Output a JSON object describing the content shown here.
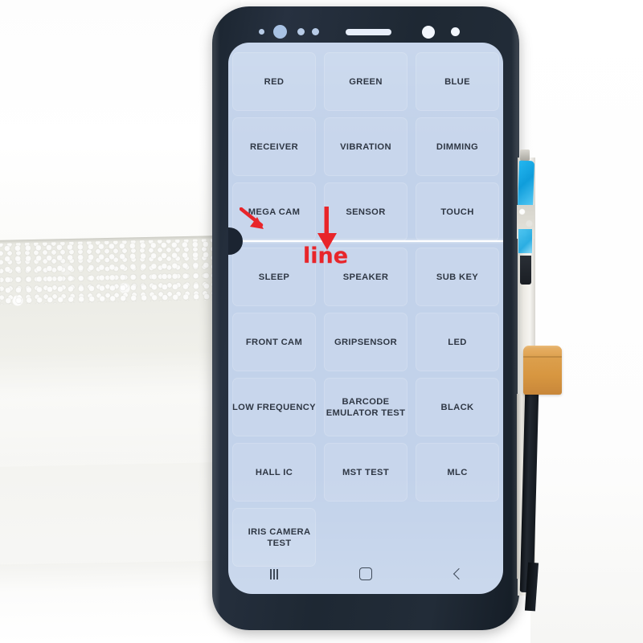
{
  "scene": {
    "subject": "Samsung Galaxy S8 display module under diagnostic test",
    "background_label": "white styrofoam foam block"
  },
  "phone": {
    "top_bezel": {
      "sensors": [
        {
          "name": "proximity-sensor-dot",
          "size": "small"
        },
        {
          "name": "iris-scanner-dot",
          "size": "large"
        },
        {
          "name": "light-sensor-dot",
          "size": "small"
        },
        {
          "name": "aux-sensor-dot",
          "size": "small"
        },
        {
          "name": "earpiece-speaker-slot",
          "size": "slot"
        },
        {
          "name": "front-camera-lens",
          "size": "camera"
        },
        {
          "name": "led-indicator",
          "size": "small-camera"
        }
      ]
    }
  },
  "screen": {
    "background_color": "#c2d2ea",
    "text_color": "#17202e",
    "grid": {
      "columns": 3,
      "rows": [
        [
          "RED",
          "GREEN",
          "BLUE"
        ],
        [
          "RECEIVER",
          "VIBRATION",
          "DIMMING"
        ],
        [
          "MEGA CAM",
          "SENSOR",
          "TOUCH"
        ],
        [
          "SLEEP",
          "SPEAKER",
          "SUB KEY"
        ],
        [
          "FRONT CAM",
          "GRIPSENSOR",
          "LED"
        ],
        [
          "LOW FREQUENCY",
          "BARCODE EMULATOR TEST",
          "BLACK"
        ],
        [
          "HALL IC",
          "MST TEST",
          "MLC"
        ],
        [
          "IRIS CAMERA TEST",
          "",
          ""
        ]
      ]
    }
  },
  "defect": {
    "type": "horizontal-white-line",
    "color": "#ffffff",
    "annotation_label": "line",
    "annotation_color": "#e8252a",
    "arrows": [
      {
        "name": "diagonal-arrow",
        "direction": "down-right"
      },
      {
        "name": "vertical-arrow",
        "direction": "down"
      }
    ]
  },
  "navbar": {
    "buttons": [
      {
        "name": "recents-button",
        "icon": "recents-icon"
      },
      {
        "name": "home-button",
        "icon": "home-icon"
      },
      {
        "name": "back-button",
        "icon": "back-icon"
      }
    ]
  },
  "hardware": {
    "flex_cable_color": "#d79640",
    "tape_color": "#1aa8e2",
    "cable_color": "#14191f",
    "parts": [
      {
        "name": "blue-adhesive-tape"
      },
      {
        "name": "orange-flex-cable"
      },
      {
        "name": "black-ribbon-cable"
      },
      {
        "name": "foil-shield-strip"
      }
    ]
  }
}
